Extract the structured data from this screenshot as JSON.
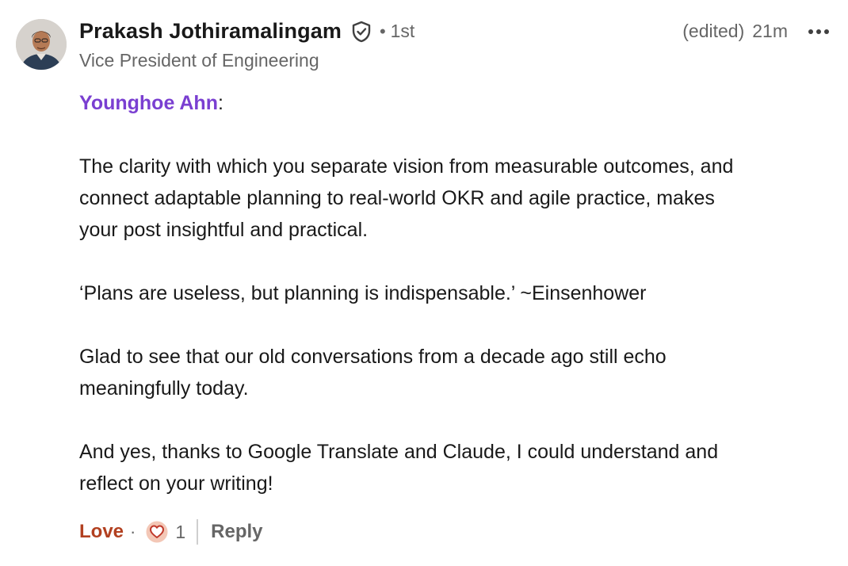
{
  "comment": {
    "author": {
      "name": "Prakash Jothiramalingam",
      "degree_separator": "•",
      "degree": "1st",
      "headline": "Vice President of Engineering",
      "verified_icon": "shield-check-icon",
      "avatar_icon": "avatar-photo"
    },
    "meta": {
      "edited": "(edited)",
      "time": "21m",
      "more_icon": "more-horizontal-icon"
    },
    "body": {
      "mention": "Younghoe Ahn",
      "mention_suffix": ":",
      "paragraph_1": "The clarity with which you separate vision from measurable outcomes, and",
      "paragraph_1b": "connect adaptable planning to real-world OKR and agile practice, makes",
      "paragraph_1c": "your post insightful and practical.",
      "paragraph_2": "‘Plans are useless, but planning is indispensable.’ ~Einsenhower",
      "paragraph_3": "Glad to see that our old conversations from a decade ago still echo",
      "paragraph_3b": "meaningfully today.",
      "paragraph_4": "And yes, thanks to Google Translate and Claude, I could understand and",
      "paragraph_4b": "reflect on your writing!"
    },
    "actions": {
      "love_label": "Love",
      "separator": "·",
      "reaction_icon": "love-reaction-icon",
      "reaction_count": "1",
      "reply_label": "Reply"
    },
    "colors": {
      "mention": "#7a3fd1",
      "love": "#b24020",
      "muted": "#666666",
      "text": "#191919"
    }
  }
}
